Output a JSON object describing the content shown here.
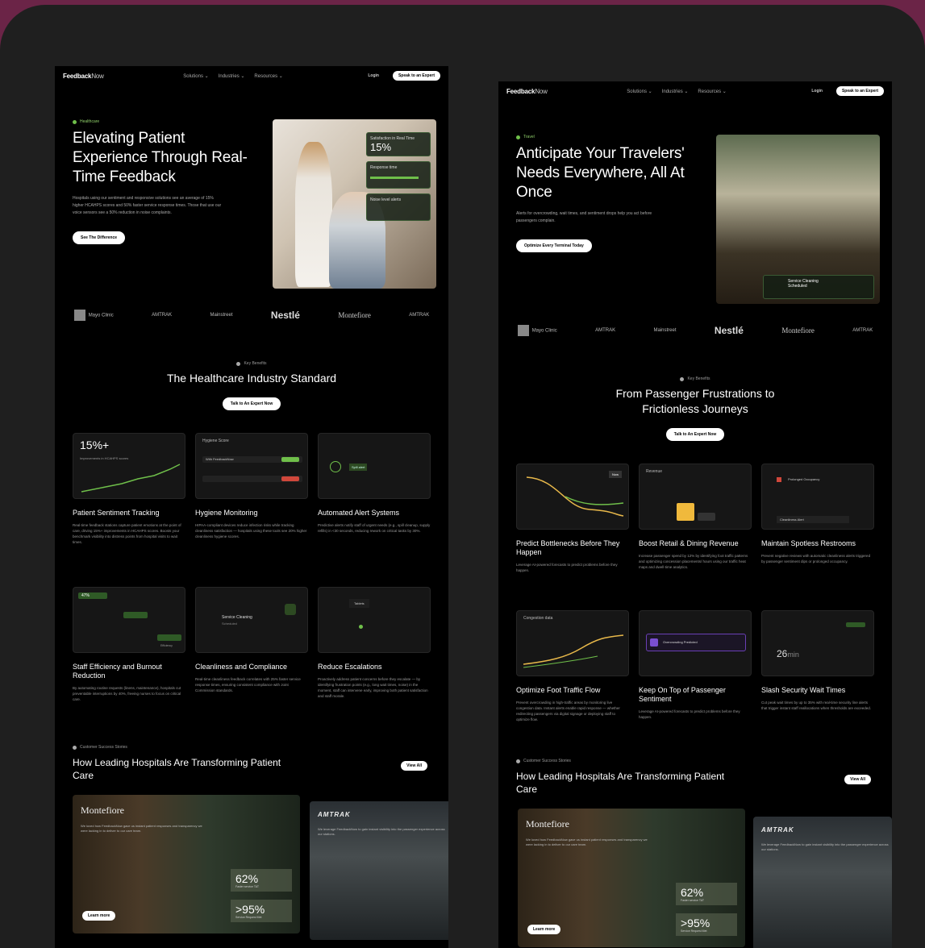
{
  "left": {
    "nav": {
      "logo_bold": "Feedback",
      "logo_light": "Now",
      "links": [
        "Solutions ⌄",
        "Industries ⌄",
        "Resources ⌄"
      ],
      "login": "Login",
      "cta": "Speak to an Expert"
    },
    "hero": {
      "tag": "Healthcare",
      "title": "Elevating Patient Experience Through Real-Time Feedback",
      "desc": "Hospitals using our sentiment and responsive solutions see an average of 15% higher HCAHPS scores and 50% faster service response times. Those that use our voice sensors see a 50% reduction in noise complaints.",
      "cta": "See The Difference",
      "card1_label": "Satisfaction in Real Time",
      "card1_value": "15%",
      "card2_label": "Response time",
      "card3_label": "Noise level alerts"
    },
    "logos": [
      "Mayo Clinic",
      "AMTRAK",
      "Mainstreet",
      "Nestlé",
      "Montefiore",
      "AMTRAK"
    ],
    "benefits": {
      "tag": "Key Benefits",
      "title": "The Healthcare Industry Standard",
      "cta": "Talk to An Expert Now"
    },
    "features": [
      {
        "card_text": "15%+",
        "card_sub": "Improvements in HCAHPS scores",
        "title": "Patient Sentiment Tracking",
        "desc": "Real-time feedback stations capture patient emotions at the point of care, driving 15%+ improvements in HCAHPS scores. Boosts your benchmark visibility into distress points from hospital visits to wait times."
      },
      {
        "card_text": "Hygiene Score",
        "card_sub": "With FeedbackNow",
        "title": "Hygiene Monitoring",
        "desc": "HIPAA-compliant devices reduce infection risks while tracking cleanliness satisfaction — hospitals using these tools see 20% higher cleanliness hygiene scores."
      },
      {
        "card_text": "Spill alert",
        "card_sub": "",
        "title": "Automated Alert Systems",
        "desc": "Predictive alerts notify staff of urgent needs (e.g., spill cleanup, supply refills) in <30 seconds, reducing rework on critical tasks by 30%."
      },
      {
        "card_text": "47%",
        "card_sub": "Efficiency",
        "title": "Staff Efficiency and Burnout Reduction",
        "desc": "By automating routine requests (linens, maintenance), hospitals cut preventable interruptions by 40%, freeing nurses to focus on critical care."
      },
      {
        "card_text": "Service Cleaning",
        "card_sub": "Scheduled",
        "title": "Cleanliness and Compliance",
        "desc": "Real-time cleanliness feedback correlates with 25% faster service response times, ensuring consistent compliance with Joint Commission standards."
      },
      {
        "card_text": "Tablets",
        "card_sub": "",
        "title": "Reduce Escalations",
        "desc": "Proactively address patient concerns before they escalate — by identifying frustration points (e.g., long wait times, noise) in the moment, staff can intervene early, improving both patient satisfaction and staff morale."
      }
    ],
    "stories": {
      "tag": "Customer Success Stories",
      "title": "How Leading Hospitals Are Transforming Patient Care",
      "cta": "View All",
      "card1_brand": "Montefiore",
      "card1_desc": "We loved how FeedbackNow gave us instant patient responses and transparency we were lacking in to deliver to our care team.",
      "stat1": "62%",
      "stat1_label": "Faster service TAT",
      "stat2": ">95%",
      "stat2_label": "Service Request Met",
      "learn": "Learn more",
      "card2_brand": "AMTRAK",
      "card2_desc": "We leverage FeedbackNow to gain instant visibility into the passenger experience across our stations."
    }
  },
  "right": {
    "nav": {
      "logo_bold": "Feedback",
      "logo_light": "Now",
      "links": [
        "Solutions ⌄",
        "Industries ⌄",
        "Resources ⌄"
      ],
      "login": "Login",
      "cta": "Speak to an Expert"
    },
    "hero": {
      "tag": "Travel",
      "title": "Anticipate Your Travelers' Needs Everywhere, All At Once",
      "desc": "Alerts for overcrowding, wait times, and sentiment drops help you act before passengers complain.",
      "cta": "Optimize Every Terminal Today",
      "card_label": "Service Cleaning Scheduled"
    },
    "logos": [
      "Mayo Clinic",
      "AMTRAK",
      "Mainstreet",
      "Nestlé",
      "Montefiore",
      "AMTRAK"
    ],
    "benefits": {
      "tag": "Key Benefits",
      "title": "From Passenger Frustrations to Frictionless Journeys",
      "cta": "Talk to An Expert Now"
    },
    "features": [
      {
        "card_text": "Now",
        "card_sub": "",
        "title": "Predict Bottlenecks Before They Happen",
        "desc": "Leverage AI-powered forecasts to predict problems before they happen."
      },
      {
        "card_text": "Revenue",
        "card_sub": "",
        "title": "Boost Retail & Dining Revenue",
        "desc": "Increase passenger spend by 12% by identifying foot traffic patterns and optimizing concession placements/ hours using our traffic heat maps and dwell-time analytics."
      },
      {
        "card_text": "Prolonged Occupancy",
        "card_sub": "Cleanliness Alert",
        "title": "Maintain Spotless Restrooms",
        "desc": "Prevent negative reviews with automatic cleanliness alerts triggered by passenger sentiment dips or prolonged occupancy."
      },
      {
        "card_text": "Congestion data",
        "card_sub": "",
        "title": "Optimize Foot Traffic Flow",
        "desc": "Prevent overcrowding in high-traffic areas by monitoring live congestion data. Instant alerts enable rapid response — whether redirecting passengers via digital signage or deploying staff to optimize flow."
      },
      {
        "card_text": "Overcrowding Predicted",
        "card_sub": "",
        "title": "Keep On Top of Passenger Sentiment",
        "desc": "Leverage AI-powered forecasts to predict problems before they happen."
      },
      {
        "card_text": "26",
        "card_sub": "min",
        "title": "Slash Security Wait Times",
        "desc": "Cut peak wait times by up to 35% with real-time security line alerts that trigger instant staff reallocations when thresholds are exceeded."
      }
    ],
    "stories": {
      "tag": "Customer Success Stories",
      "title": "How Leading Hospitals Are Transforming Patient Care",
      "cta": "View All",
      "card1_brand": "Montefiore",
      "card1_desc": "We loved how FeedbackNow gave us instant patient responses and transparency we were lacking in to deliver to our care team.",
      "stat1": "62%",
      "stat1_label": "Faster service TAT",
      "stat2": ">95%",
      "stat2_label": "Service Request Met",
      "learn": "Learn more",
      "card2_brand": "AMTRAK",
      "card2_desc": "We leverage FeedbackNow to gain instant visibility into the passenger experience across our stations."
    }
  },
  "colors": {
    "accent": "#6fbf4a",
    "background": "#000000",
    "frame": "#1f1f1f",
    "outer": "#6b2447"
  }
}
